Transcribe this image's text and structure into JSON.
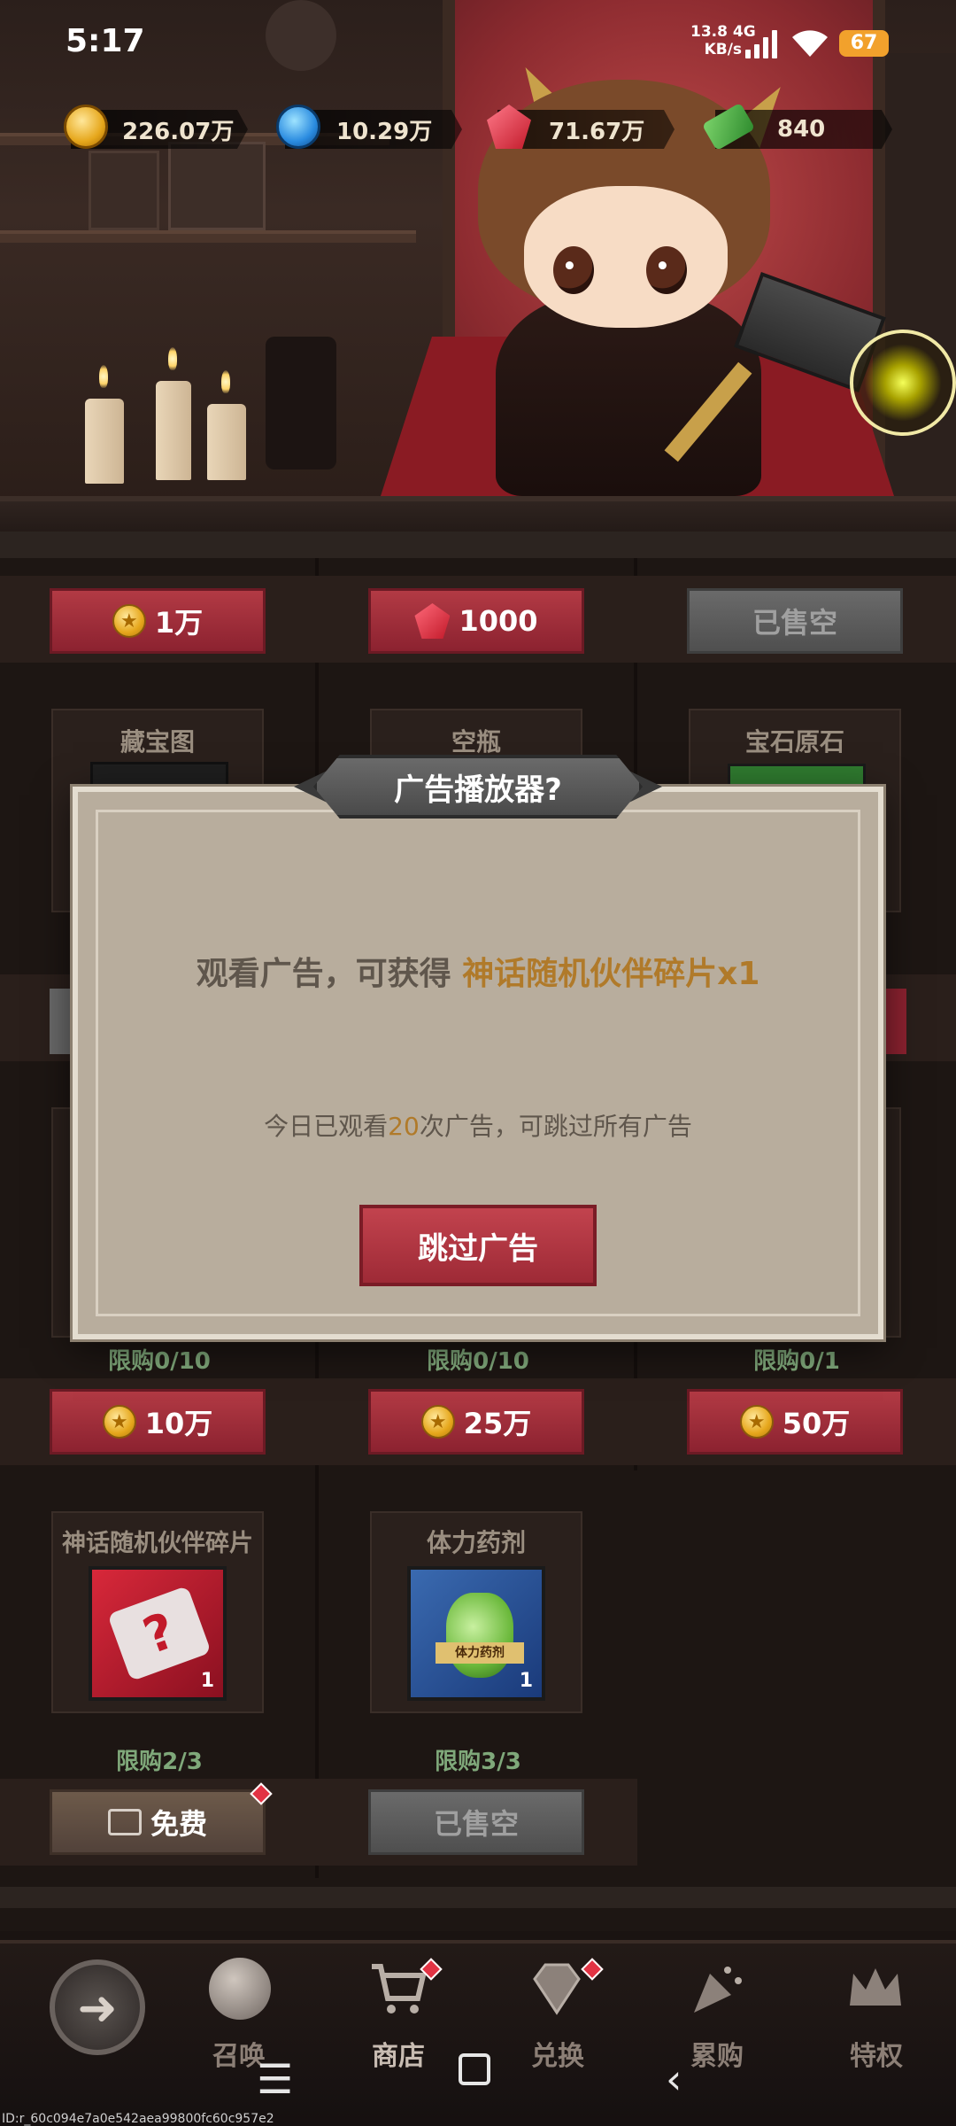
{
  "status_bar": {
    "time": "5:17",
    "net_speed": "13.8",
    "net_unit": "KB/s",
    "net_type": "4G",
    "battery": "67"
  },
  "currencies": [
    {
      "name": "gold",
      "value": "226.07万",
      "icon": "gold-coin-icon",
      "color": "#e6a71c"
    },
    {
      "name": "water",
      "value": "10.29万",
      "icon": "blue-orb-icon",
      "color": "#2a8be0"
    },
    {
      "name": "ruby",
      "value": "71.67万",
      "icon": "ruby-icon",
      "color": "#d02a3a"
    },
    {
      "name": "cash",
      "value": "840",
      "icon": "cash-icon",
      "color": "#4caf50"
    }
  ],
  "shop": {
    "row1_prices": [
      {
        "label": "1万",
        "type": "coin"
      },
      {
        "label": "1000",
        "type": "gem"
      },
      {
        "label": "已售空",
        "type": "soldout"
      }
    ],
    "row2_titles": [
      "藏宝图",
      "空瓶",
      "宝石原石"
    ],
    "row3_limits": [
      "限购0/10",
      "限购0/10",
      "限购0/1"
    ],
    "row3_prices": [
      "10万",
      "25万",
      "50万"
    ],
    "row4_items": [
      {
        "title": "神话随机伙伴碎片",
        "count": "1",
        "limit": "限购2/3",
        "button": "免费"
      },
      {
        "title": "体力药剂",
        "count": "1",
        "limit": "限购3/3",
        "button": "已售空",
        "label_on_item": "体力药剂"
      }
    ]
  },
  "dialog": {
    "title": "广告播放器?",
    "message_prefix": "观看广告，可获得 ",
    "message_highlight": "神话随机伙伴碎片x1",
    "sub_prefix": "今日已观看",
    "sub_count": "20",
    "sub_suffix": "次广告，可跳过所有广告",
    "skip_button": "跳过广告"
  },
  "bottom_nav": {
    "back_icon": "back-arrow-icon",
    "items": [
      {
        "label": "召唤",
        "icon": "crystal-ball-icon"
      },
      {
        "label": "商店",
        "icon": "cart-icon"
      },
      {
        "label": "兑换",
        "icon": "diamond-icon"
      },
      {
        "label": "累购",
        "icon": "party-popper-icon"
      },
      {
        "label": "特权",
        "icon": "crown-icon"
      }
    ]
  },
  "footer_id": "ID:r_60c094e7a0e542aea99800fc60c957e2"
}
